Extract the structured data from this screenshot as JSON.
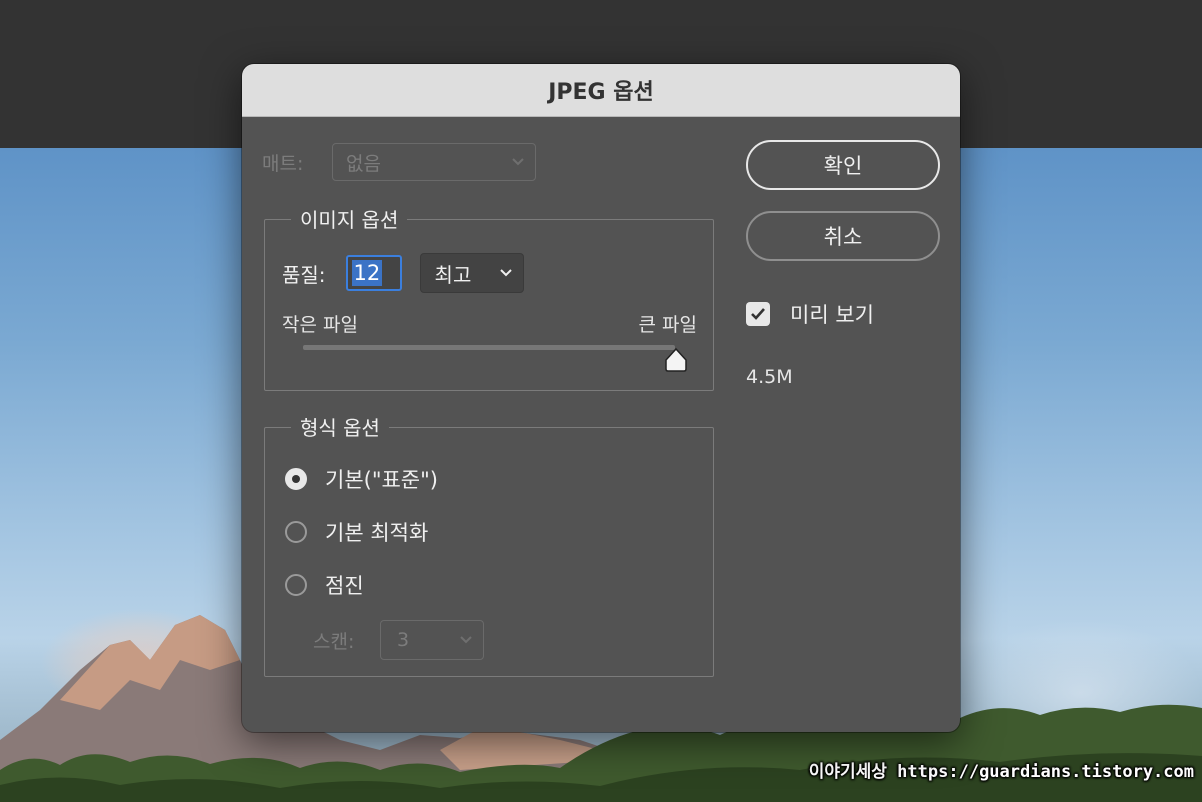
{
  "dialog": {
    "title": "JPEG 옵션"
  },
  "matte": {
    "label": "매트:",
    "value": "없음"
  },
  "image_options": {
    "title": "이미지 옵션",
    "quality_label": "품질:",
    "quality_value": "12",
    "quality_preset": "최고",
    "small_file_label": "작은 파일",
    "large_file_label": "큰 파일",
    "slider_level_fraction": 1.0
  },
  "format_options": {
    "title": "형식 옵션",
    "options": [
      {
        "label": "기본(\"표준\")",
        "checked": true
      },
      {
        "label": "기본 최적화",
        "checked": false
      },
      {
        "label": "점진",
        "checked": false
      }
    ],
    "scan_label": "스캔:",
    "scan_value": "3"
  },
  "buttons": {
    "ok": "확인",
    "cancel": "취소"
  },
  "preview": {
    "label": "미리 보기",
    "checked": true,
    "file_size": "4.5M"
  },
  "watermark": "이야기세상 https://guardians.tistory.com",
  "colors": {
    "dialog_bg": "#535353",
    "titlebar_bg": "#dedede",
    "accent_blue": "#3b7fde"
  }
}
